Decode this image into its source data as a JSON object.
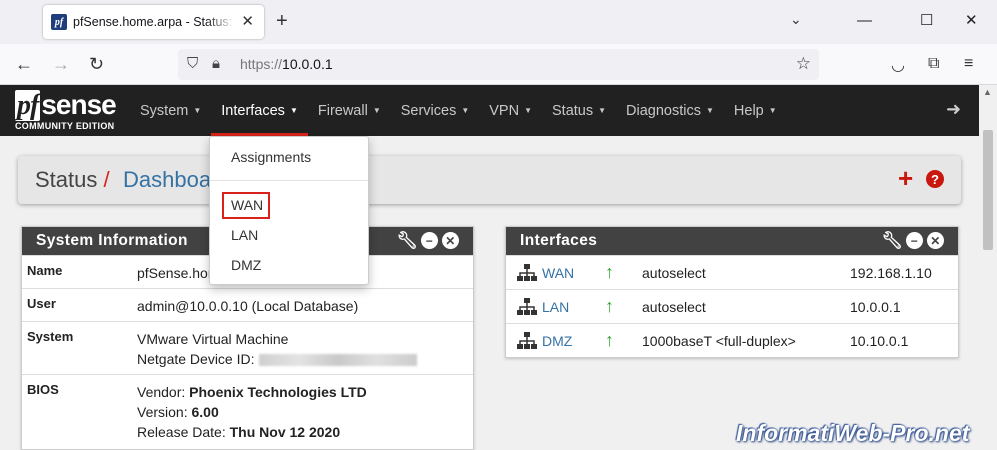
{
  "browser": {
    "tab_title": "pfSense.home.arpa - Status: Dashboard",
    "favicon_text": "pf",
    "url_scheme": "https://",
    "url_host": "10.0.0.1"
  },
  "pfsense": {
    "logo_main": "sense",
    "logo_pf": "pf",
    "logo_sub": "COMMUNITY EDITION",
    "menu": [
      "System",
      "Interfaces",
      "Firewall",
      "Services",
      "VPN",
      "Status",
      "Diagnostics",
      "Help"
    ],
    "active_menu": "Interfaces",
    "accent_color": "#d9231a"
  },
  "breadcrumb": {
    "section": "Status",
    "separator": "/",
    "page": "Dashboard"
  },
  "dropdown": {
    "items": [
      "Assignments",
      "WAN",
      "LAN",
      "DMZ"
    ],
    "highlighted": "WAN"
  },
  "system_info": {
    "title": "System Information",
    "rows": [
      {
        "label": "Name",
        "value": "pfSense.home.arpa"
      },
      {
        "label": "User",
        "value": "admin@10.0.0.10 (Local Database)"
      },
      {
        "label": "System",
        "line1": "VMware Virtual Machine",
        "line2_label": "Netgate Device ID:"
      },
      {
        "label": "BIOS",
        "vendor_label": "Vendor:",
        "vendor": "Phoenix Technologies LTD",
        "version_label": "Version:",
        "version": "6.00",
        "release_label": "Release Date:",
        "release": "Thu Nov 12 2020"
      }
    ]
  },
  "interfaces": {
    "title": "Interfaces",
    "rows": [
      {
        "name": "WAN",
        "status": "up",
        "media": "autoselect",
        "ip": "192.168.1.10"
      },
      {
        "name": "LAN",
        "status": "up",
        "media": "autoselect",
        "ip": "10.0.0.1"
      },
      {
        "name": "DMZ",
        "status": "up",
        "media": "1000baseT <full-duplex>",
        "ip": "10.10.0.1"
      }
    ]
  },
  "watermark": "InformatiWeb-Pro.net"
}
